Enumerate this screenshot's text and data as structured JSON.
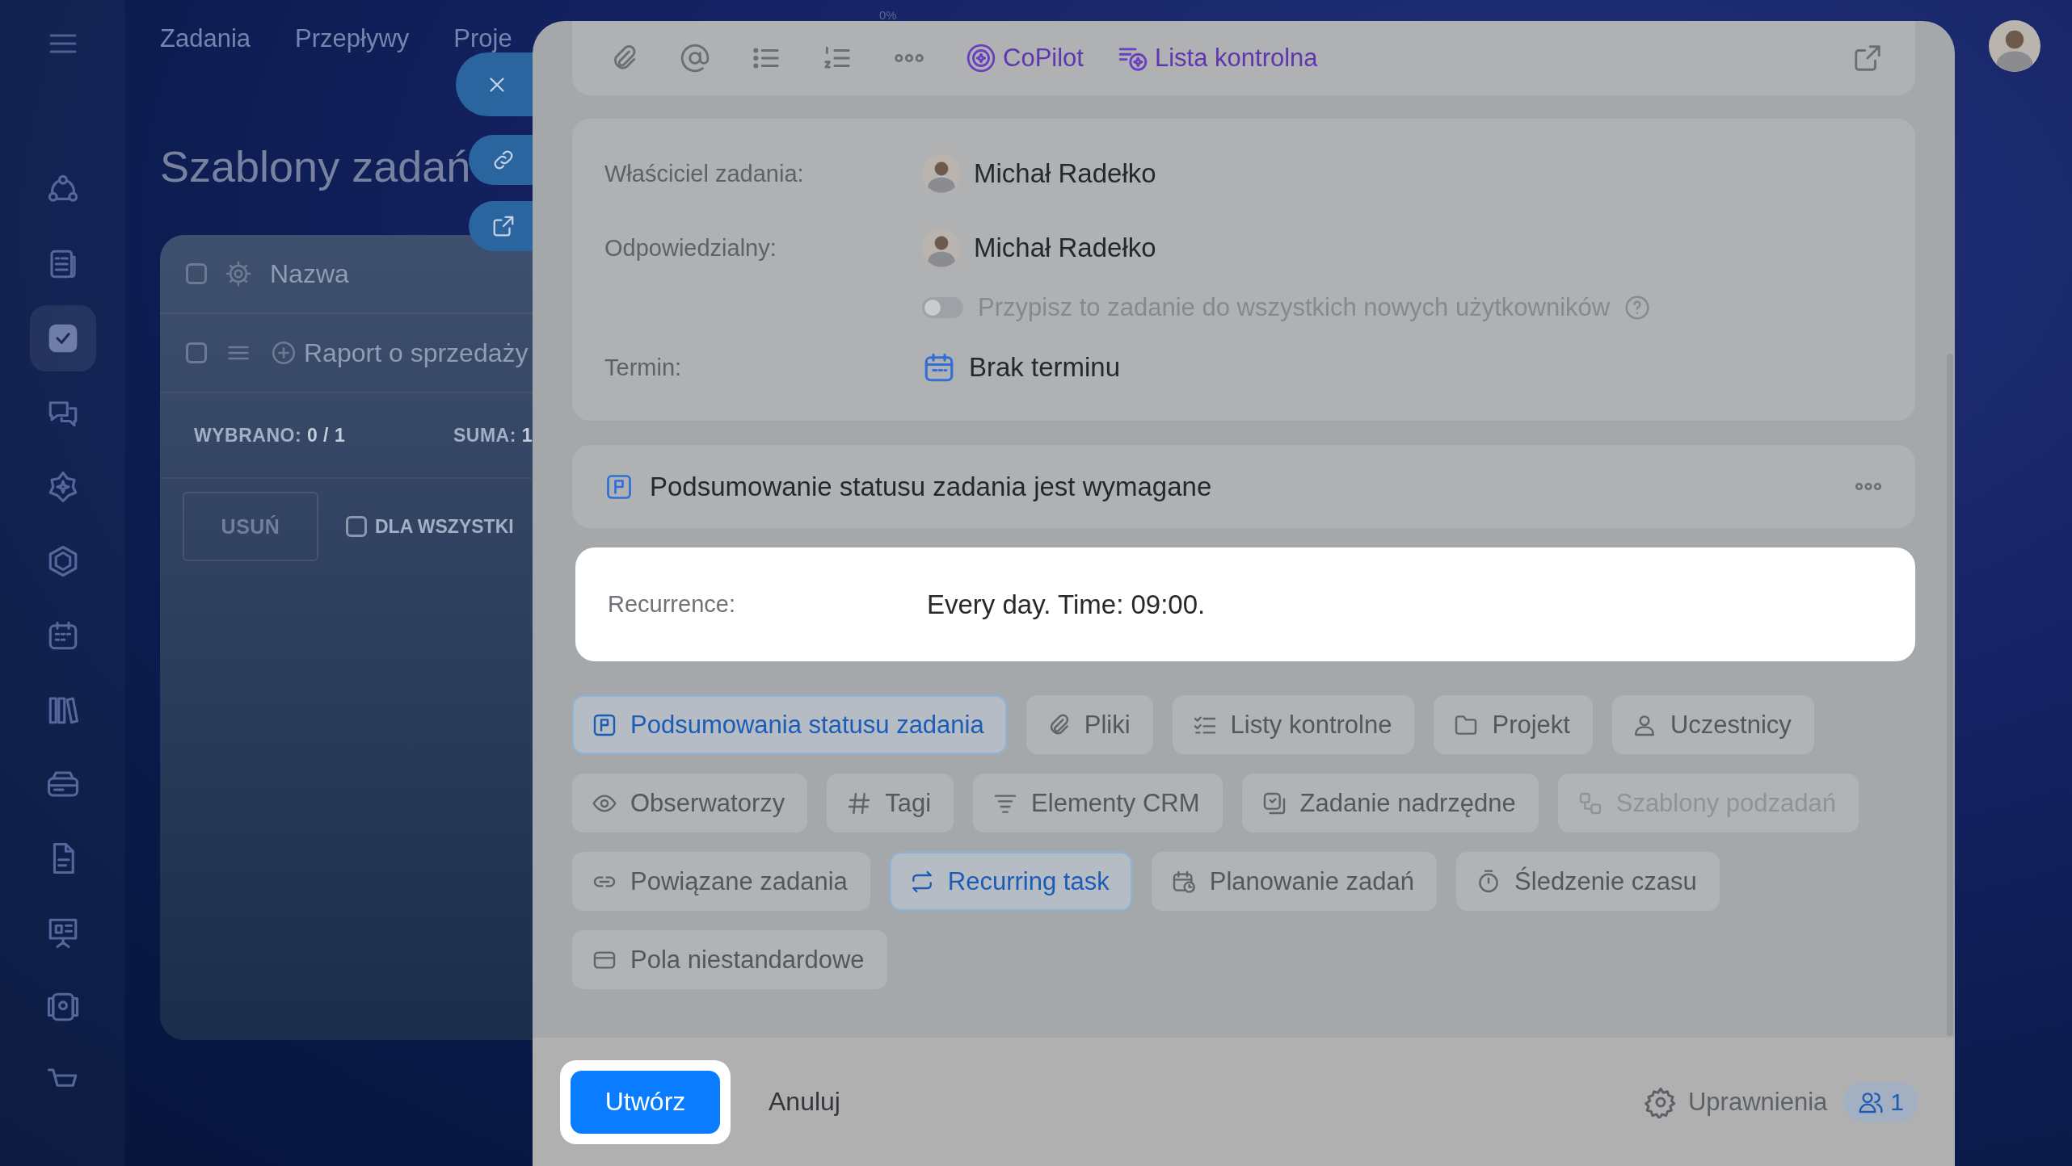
{
  "sidebar": {
    "items": [
      {
        "selected": false
      },
      {
        "selected": false
      },
      {
        "selected": true
      },
      {
        "selected": false
      },
      {
        "selected": false
      },
      {
        "selected": false
      },
      {
        "selected": false
      },
      {
        "selected": false
      },
      {
        "selected": false
      },
      {
        "selected": false
      },
      {
        "selected": false
      },
      {
        "selected": false
      },
      {
        "selected": false
      }
    ]
  },
  "top_nav": {
    "items": [
      "Zadania",
      "Przepływy",
      "Proje"
    ]
  },
  "page": {
    "title": "Szablony zadań"
  },
  "grid": {
    "header": {
      "label": "Nazwa",
      "checked": false
    },
    "rows": [
      {
        "name": "Raport o sprzedaży",
        "checked": false
      }
    ],
    "summary": {
      "selected_label": "WYBRANO:",
      "selected_value": "0 / 1",
      "total_label": "SUMA:",
      "total_value": "1"
    },
    "delete_button": "USUŃ",
    "for_all": {
      "label": "DLA WSZYSTKI",
      "checked": false
    }
  },
  "progress_label": "0%",
  "panel": {
    "toolbar": {
      "copilot": "CoPilot",
      "checklist": "Lista kontrolna"
    },
    "owner": {
      "label": "Właściciel zadania:",
      "value": "Michał Radełko"
    },
    "responsible": {
      "label": "Odpowiedzialny:",
      "value": "Michał Radełko"
    },
    "assign_all": {
      "label": "Przypisz to zadanie do wszystkich nowych użytkowników",
      "on": false
    },
    "deadline": {
      "label": "Termin:",
      "value": "Brak terminu"
    },
    "status_summary": {
      "text": "Podsumowanie statusu zadania jest wymagane"
    },
    "recurrence": {
      "label": "Recurrence:",
      "value": "Every day. Time: 09:00."
    },
    "chip_rows": [
      [
        {
          "label": "Podsumowania statusu zadania",
          "selected": true,
          "disabled": false
        },
        {
          "label": "Pliki",
          "selected": false,
          "disabled": false
        },
        {
          "label": "Listy kontrolne",
          "selected": false,
          "disabled": false
        },
        {
          "label": "Projekt",
          "selected": false,
          "disabled": false
        },
        {
          "label": "Uczestnicy",
          "selected": false,
          "disabled": false
        }
      ],
      [
        {
          "label": "Obserwatorzy",
          "selected": false,
          "disabled": false
        },
        {
          "label": "Tagi",
          "selected": false,
          "disabled": false
        },
        {
          "label": "Elementy CRM",
          "selected": false,
          "disabled": false
        },
        {
          "label": "Zadanie nadrzędne",
          "selected": false,
          "disabled": false
        },
        {
          "label": "Szablony podzadań",
          "selected": false,
          "disabled": true
        }
      ],
      [
        {
          "label": "Powiązane zadania",
          "selected": false,
          "disabled": false
        },
        {
          "label": "Recurring task",
          "selected": true,
          "disabled": false
        },
        {
          "label": "Planowanie zadań",
          "selected": false,
          "disabled": false
        },
        {
          "label": "Śledzenie czasu",
          "selected": false,
          "disabled": false
        }
      ],
      [
        {
          "label": "Pola niestandardowe",
          "selected": false,
          "disabled": false
        }
      ]
    ]
  },
  "footer": {
    "create": "Utwórz",
    "cancel": "Anuluj",
    "permissions": "Uprawnienia",
    "permissions_count": "1"
  }
}
